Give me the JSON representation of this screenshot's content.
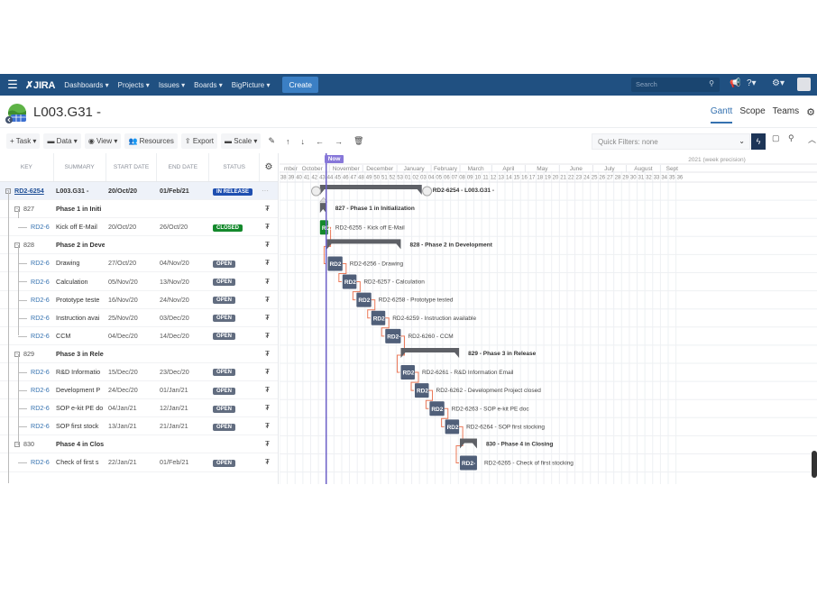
{
  "nav": {
    "logo": "JIRA",
    "items": [
      "Dashboards ▾",
      "Projects ▾",
      "Issues ▾",
      "Boards ▾",
      "BigPicture ▾"
    ],
    "create": "Create",
    "search_placeholder": "Search"
  },
  "project": {
    "title": "L003.G31 -",
    "tabs": [
      "Gantt",
      "Scope",
      "Teams"
    ],
    "active_tab": "Gantt"
  },
  "toolbar": {
    "task": "+ Task ▾",
    "data": "Data ▾",
    "view": "View ▾",
    "resources": "Resources",
    "export": "Export",
    "scale": "Scale ▾",
    "quick_filters": "Quick Filters: none"
  },
  "table": {
    "headers": [
      "KEY",
      "SUMMARY",
      "START DATE",
      "END DATE",
      "STATUS"
    ],
    "rows": [
      {
        "type": "top",
        "key": "RD2-6254",
        "summary": "L003.G31 -",
        "start": "20/Oct/20",
        "end": "01/Feb/21",
        "status": "IN RELEASE",
        "status_kind": "release"
      },
      {
        "type": "epic",
        "key": "827",
        "summary": "Phase 1 in Initi",
        "start": "",
        "end": "",
        "status": ""
      },
      {
        "type": "task",
        "key": "RD2-6",
        "summary": "Kick off E-Mail",
        "start": "20/Oct/20",
        "end": "26/Oct/20",
        "status": "CLOSED",
        "status_kind": "closed"
      },
      {
        "type": "epic",
        "key": "828",
        "summary": "Phase 2 in Deve",
        "start": "",
        "end": "",
        "status": ""
      },
      {
        "type": "task",
        "key": "RD2-6",
        "summary": "Drawing",
        "start": "27/Oct/20",
        "end": "04/Nov/20",
        "status": "OPEN",
        "status_kind": "open"
      },
      {
        "type": "task",
        "key": "RD2-6",
        "summary": "Calculation",
        "start": "05/Nov/20",
        "end": "13/Nov/20",
        "status": "OPEN",
        "status_kind": "open"
      },
      {
        "type": "task",
        "key": "RD2-6",
        "summary": "Prototype teste",
        "start": "16/Nov/20",
        "end": "24/Nov/20",
        "status": "OPEN",
        "status_kind": "open"
      },
      {
        "type": "task",
        "key": "RD2-6",
        "summary": "Instruction avai",
        "start": "25/Nov/20",
        "end": "03/Dec/20",
        "status": "OPEN",
        "status_kind": "open"
      },
      {
        "type": "task",
        "key": "RD2-6",
        "summary": "CCM",
        "start": "04/Dec/20",
        "end": "14/Dec/20",
        "status": "OPEN",
        "status_kind": "open"
      },
      {
        "type": "epic",
        "key": "829",
        "summary": "Phase 3 in Rele",
        "start": "",
        "end": "",
        "status": ""
      },
      {
        "type": "task",
        "key": "RD2-6",
        "summary": "R&D Informatio",
        "start": "15/Dec/20",
        "end": "23/Dec/20",
        "status": "OPEN",
        "status_kind": "open"
      },
      {
        "type": "task",
        "key": "RD2-6",
        "summary": "Development P",
        "start": "24/Dec/20",
        "end": "01/Jan/21",
        "status": "OPEN",
        "status_kind": "open"
      },
      {
        "type": "task",
        "key": "RD2-6",
        "summary": "SOP e-kit PE do",
        "start": "04/Jan/21",
        "end": "12/Jan/21",
        "status": "OPEN",
        "status_kind": "open"
      },
      {
        "type": "task",
        "key": "RD2-6",
        "summary": "SOP first stock",
        "start": "13/Jan/21",
        "end": "21/Jan/21",
        "status": "OPEN",
        "status_kind": "open"
      },
      {
        "type": "epic",
        "key": "830",
        "summary": "Phase 4 in Clos",
        "start": "",
        "end": "",
        "status": ""
      },
      {
        "type": "task",
        "key": "RD2-6",
        "summary": "Check of first s",
        "start": "22/Jan/21",
        "end": "01/Feb/21",
        "status": "OPEN",
        "status_kind": "open"
      }
    ]
  },
  "gantt": {
    "now_label": "Now",
    "now_week": 44,
    "precision_label": "2021 (week precision)",
    "months": [
      "mber",
      "October",
      "November",
      "December",
      "January",
      "February",
      "March",
      "April",
      "May",
      "June",
      "July",
      "August",
      "Sept"
    ],
    "weeks": [
      "38",
      "39",
      "40",
      "41",
      "42",
      "43",
      "44",
      "45",
      "46",
      "47",
      "48",
      "49",
      "50",
      "51",
      "52",
      "53",
      "01",
      "02",
      "03",
      "04",
      "05",
      "06",
      "07",
      "08",
      "09",
      "10",
      "11",
      "12",
      "13",
      "14",
      "15",
      "16",
      "17",
      "18",
      "19",
      "20",
      "21",
      "22",
      "23",
      "24",
      "25",
      "26",
      "27",
      "28",
      "29",
      "30",
      "31",
      "32",
      "33",
      "34",
      "35",
      "36"
    ],
    "bars": [
      {
        "kind": "summary",
        "label": "RD2-6254 - L003.G31 -",
        "start_week": 43.2,
        "end_week": 56.3
      },
      {
        "kind": "summary",
        "label": "827 - Phase 1 in Initialization",
        "start_week": 43.2,
        "end_week": 44.0
      },
      {
        "kind": "task",
        "label": "RD2-6255 - Kick off E-Mail",
        "bar_text": "RD2",
        "start_week": 43.2,
        "end_week": 44.1,
        "color": "#14892c"
      },
      {
        "kind": "summary",
        "label": "828 - Phase 2 in Development",
        "start_week": 44.1,
        "end_week": 53.6
      },
      {
        "kind": "task",
        "label": "RD2-6256 - Drawing",
        "bar_text": "RD2",
        "start_week": 44.2,
        "end_week": 46.1,
        "color": "#505f79"
      },
      {
        "kind": "task",
        "label": "RD2-6257 - Calculation",
        "bar_text": "RD2",
        "start_week": 46.1,
        "end_week": 47.9,
        "color": "#505f79"
      },
      {
        "kind": "task",
        "label": "RD2-6258 - Prototype tested",
        "bar_text": "RD2",
        "start_week": 47.9,
        "end_week": 49.8,
        "color": "#505f79"
      },
      {
        "kind": "task",
        "label": "RD2-6259 - Instruction available",
        "bar_text": "RD2",
        "start_week": 49.8,
        "end_week": 51.6,
        "color": "#505f79"
      },
      {
        "kind": "task",
        "label": "RD2-6260 - CCM",
        "bar_text": "RD2-",
        "start_week": 51.6,
        "end_week": 53.6,
        "color": "#505f79"
      },
      {
        "kind": "summary",
        "label": "829 - Phase 3 in Release",
        "start_week": 53.6,
        "end_week": 61.1
      },
      {
        "kind": "task",
        "label": "RD2-6261 - R&D Information Email",
        "bar_text": "RD2",
        "start_week": 53.6,
        "end_week": 55.4,
        "color": "#505f79"
      },
      {
        "kind": "task",
        "label": "RD2-6262 - Development Project closed",
        "bar_text": "RD2",
        "start_week": 55.4,
        "end_week": 57.2,
        "color": "#505f79"
      },
      {
        "kind": "task",
        "label": "RD2-6263 - SOP e-kit PE doc",
        "bar_text": "RD2",
        "start_week": 57.3,
        "end_week": 59.2,
        "color": "#505f79"
      },
      {
        "kind": "task",
        "label": "RD2-6264 - SOP first stocking",
        "bar_text": "RD2",
        "start_week": 59.3,
        "end_week": 61.1,
        "color": "#505f79"
      },
      {
        "kind": "summary",
        "label": "830 - Phase 4 in Closing",
        "start_week": 61.2,
        "end_week": 63.4
      },
      {
        "kind": "task",
        "label": "RD2-6265 - Check of first stocking",
        "bar_text": "RD2-",
        "start_week": 61.2,
        "end_week": 63.4,
        "color": "#505f79"
      }
    ]
  },
  "colors": {
    "nav_bg": "#205081",
    "now_line": "#6c5fc7",
    "dependency": "#e8623c",
    "summary_bar": "#5e6066"
  }
}
